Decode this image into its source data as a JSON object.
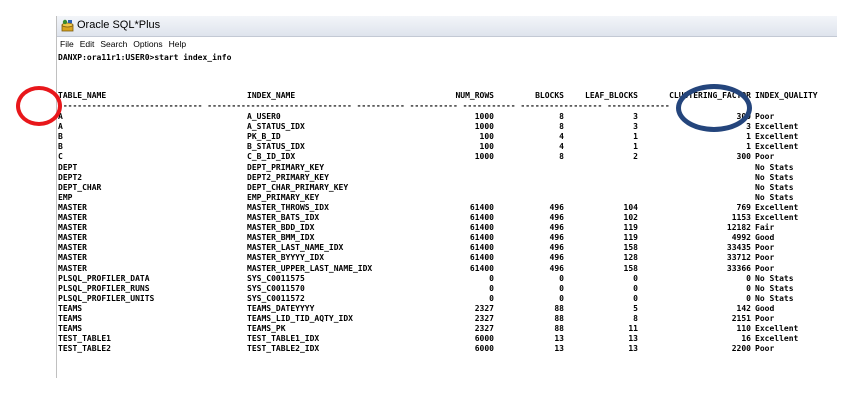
{
  "window": {
    "title": "Oracle SQL*Plus",
    "menu": [
      "File",
      "Edit",
      "Search",
      "Options",
      "Help"
    ]
  },
  "console": {
    "prompt": "DANXP:ora11r1:USER0>start index_info",
    "headers": {
      "table_name": "TABLE_NAME",
      "index_name": "INDEX_NAME",
      "num_rows": "NUM_ROWS",
      "blocks": "BLOCKS",
      "leaf_blocks": "LEAF_BLOCKS",
      "clustering_factor": "CLUSTERING_FACTOR",
      "index_quality": "INDEX_QUALITY"
    },
    "separator": "------------------------------ ------------------------------ ---------- ---------- ----------- ----------------- -------------",
    "rows": [
      {
        "table": "A",
        "index": "A_USER0",
        "num_rows": "1000",
        "blocks": "8",
        "leaf": "3",
        "clus": "300",
        "quality": "Poor"
      },
      {
        "table": "A",
        "index": "A_STATUS_IDX",
        "num_rows": "1000",
        "blocks": "8",
        "leaf": "3",
        "clus": "3",
        "quality": "Excellent"
      },
      {
        "table": "B",
        "index": "PK_B_ID",
        "num_rows": "100",
        "blocks": "4",
        "leaf": "1",
        "clus": "1",
        "quality": "Excellent"
      },
      {
        "table": "B",
        "index": "B_STATUS_IDX",
        "num_rows": "100",
        "blocks": "4",
        "leaf": "1",
        "clus": "1",
        "quality": "Excellent"
      },
      {
        "table": "C",
        "index": "C_B_ID_IDX",
        "num_rows": "1000",
        "blocks": "8",
        "leaf": "2",
        "clus": "300",
        "quality": "Poor"
      },
      {
        "table": "DEPT",
        "index": "DEPT_PRIMARY_KEY",
        "num_rows": "",
        "blocks": "",
        "leaf": "",
        "clus": "",
        "quality": "No Stats"
      },
      {
        "table": "DEPT2",
        "index": "DEPT2_PRIMARY_KEY",
        "num_rows": "",
        "blocks": "",
        "leaf": "",
        "clus": "",
        "quality": "No Stats"
      },
      {
        "table": "DEPT_CHAR",
        "index": "DEPT_CHAR_PRIMARY_KEY",
        "num_rows": "",
        "blocks": "",
        "leaf": "",
        "clus": "",
        "quality": "No Stats"
      },
      {
        "table": "EMP",
        "index": "EMP_PRIMARY_KEY",
        "num_rows": "",
        "blocks": "",
        "leaf": "",
        "clus": "",
        "quality": "No Stats"
      },
      {
        "table": "MASTER",
        "index": "MASTER_THROWS_IDX",
        "num_rows": "61400",
        "blocks": "496",
        "leaf": "104",
        "clus": "769",
        "quality": "Excellent"
      },
      {
        "table": "MASTER",
        "index": "MASTER_BATS_IDX",
        "num_rows": "61400",
        "blocks": "496",
        "leaf": "102",
        "clus": "1153",
        "quality": "Excellent"
      },
      {
        "table": "MASTER",
        "index": "MASTER_BDD_IDX",
        "num_rows": "61400",
        "blocks": "496",
        "leaf": "119",
        "clus": "12182",
        "quality": "Fair"
      },
      {
        "table": "MASTER",
        "index": "MASTER_BMM_IDX",
        "num_rows": "61400",
        "blocks": "496",
        "leaf": "119",
        "clus": "4992",
        "quality": "Good"
      },
      {
        "table": "MASTER",
        "index": "MASTER_LAST_NAME_IDX",
        "num_rows": "61400",
        "blocks": "496",
        "leaf": "158",
        "clus": "33435",
        "quality": "Poor"
      },
      {
        "table": "MASTER",
        "index": "MASTER_BYYYY_IDX",
        "num_rows": "61400",
        "blocks": "496",
        "leaf": "128",
        "clus": "33712",
        "quality": "Poor"
      },
      {
        "table": "MASTER",
        "index": "MASTER_UPPER_LAST_NAME_IDX",
        "num_rows": "61400",
        "blocks": "496",
        "leaf": "158",
        "clus": "33366",
        "quality": "Poor"
      },
      {
        "table": "PLSQL_PROFILER_DATA",
        "index": "SYS_C0011575",
        "num_rows": "0",
        "blocks": "0",
        "leaf": "0",
        "clus": "0",
        "quality": "No Stats"
      },
      {
        "table": "PLSQL_PROFILER_RUNS",
        "index": "SYS_C0011570",
        "num_rows": "0",
        "blocks": "0",
        "leaf": "0",
        "clus": "0",
        "quality": "No Stats"
      },
      {
        "table": "PLSQL_PROFILER_UNITS",
        "index": "SYS_C0011572",
        "num_rows": "0",
        "blocks": "0",
        "leaf": "0",
        "clus": "0",
        "quality": "No Stats"
      },
      {
        "table": "TEAMS",
        "index": "TEAMS_DATEYYYY",
        "num_rows": "2327",
        "blocks": "88",
        "leaf": "5",
        "clus": "142",
        "quality": "Good"
      },
      {
        "table": "TEAMS",
        "index": "TEAMS_LID_TID_AQTY_IDX",
        "num_rows": "2327",
        "blocks": "88",
        "leaf": "8",
        "clus": "2151",
        "quality": "Poor"
      },
      {
        "table": "TEAMS",
        "index": "TEAMS_PK",
        "num_rows": "2327",
        "blocks": "88",
        "leaf": "11",
        "clus": "110",
        "quality": "Excellent"
      },
      {
        "table": "TEST_TABLE1",
        "index": "TEST_TABLE1_IDX",
        "num_rows": "6000",
        "blocks": "13",
        "leaf": "13",
        "clus": "16",
        "quality": "Excellent"
      },
      {
        "table": "TEST_TABLE2",
        "index": "TEST_TABLE2_IDX",
        "num_rows": "6000",
        "blocks": "13",
        "leaf": "13",
        "clus": "2200",
        "quality": "Poor"
      }
    ]
  },
  "annotations": {
    "red_circle_color": "#e8171b",
    "blue_circle_color": "#24457c"
  }
}
